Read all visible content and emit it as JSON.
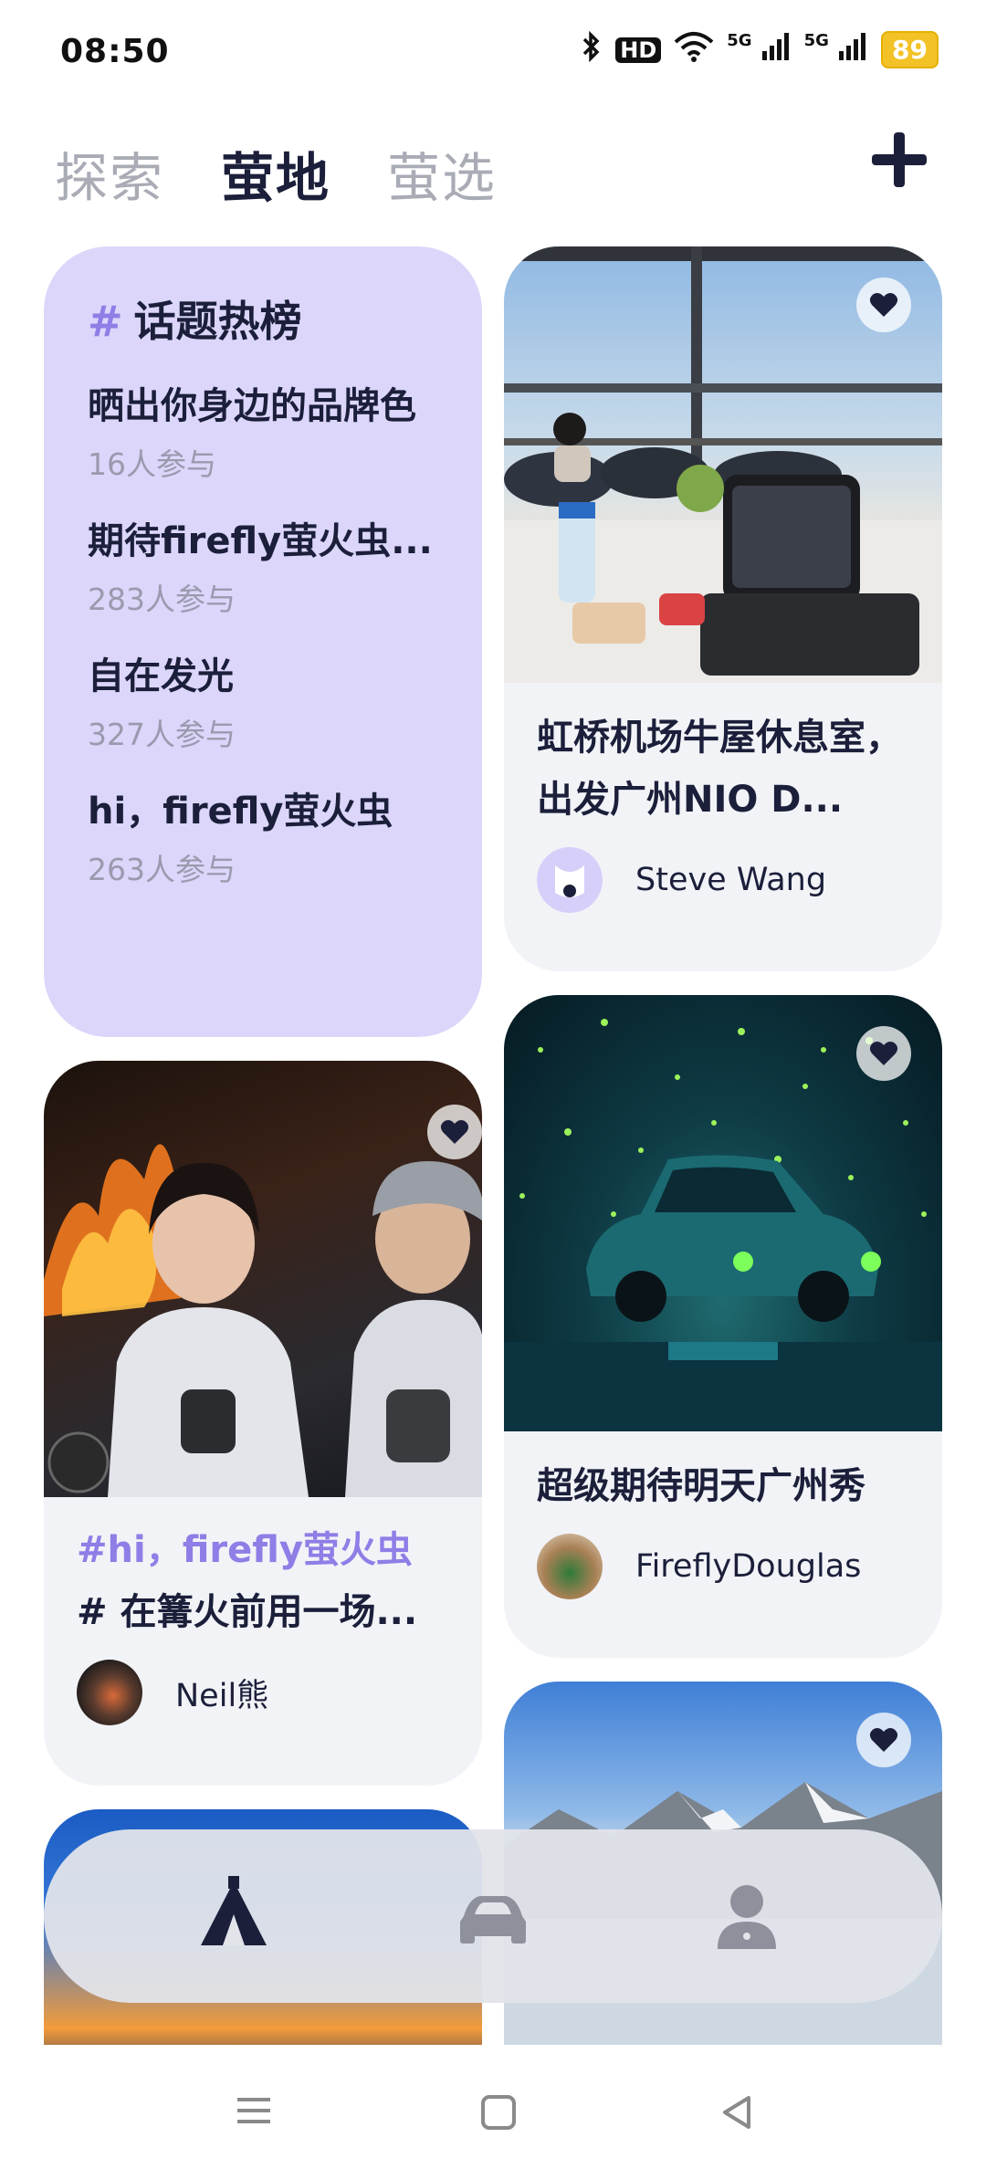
{
  "status_bar": {
    "time": "08:50",
    "hd_label": "HD",
    "network_1": "5G",
    "network_2": "5G",
    "battery": "89"
  },
  "tabs": [
    {
      "label": "探索"
    },
    {
      "label": "萤地"
    },
    {
      "label": "萤选"
    }
  ],
  "active_tab": "萤地",
  "hot_topics": {
    "title": "话题热榜",
    "items": [
      {
        "name": "晒出你身边的品牌色",
        "count": "16人参与"
      },
      {
        "name": "期待firefly萤火虫...",
        "count": "283人参与"
      },
      {
        "name": "自在发光",
        "count": "327人参与"
      },
      {
        "name": "hi，firefly萤火虫",
        "count": "263人参与"
      }
    ]
  },
  "posts": [
    {
      "title": "虹桥机场牛屋休息室，出发广州NIO D...",
      "author": "Steve Wang",
      "image_icon": "airport-lounge-photo"
    },
    {
      "tag": "#hi，firefly萤火虫",
      "title": "# 在篝火前用一场...",
      "author": "Neil熊",
      "image_icon": "campfire-photo"
    },
    {
      "title": "超级期待明天广州秀",
      "author": "FireflyDouglas",
      "image_icon": "firefly-car-photo"
    },
    {
      "image_icon": "mountain-lake-photo"
    },
    {
      "image_icon": "sunset-photo"
    }
  ],
  "bottom_nav": [
    {
      "icon": "tent-icon",
      "active": true
    },
    {
      "icon": "car-icon",
      "active": false
    },
    {
      "icon": "profile-icon",
      "active": false
    }
  ],
  "colors": {
    "primary": "#1b1f3a",
    "accent": "#8e7ee6",
    "hot_bg": "#dcd6fb"
  }
}
